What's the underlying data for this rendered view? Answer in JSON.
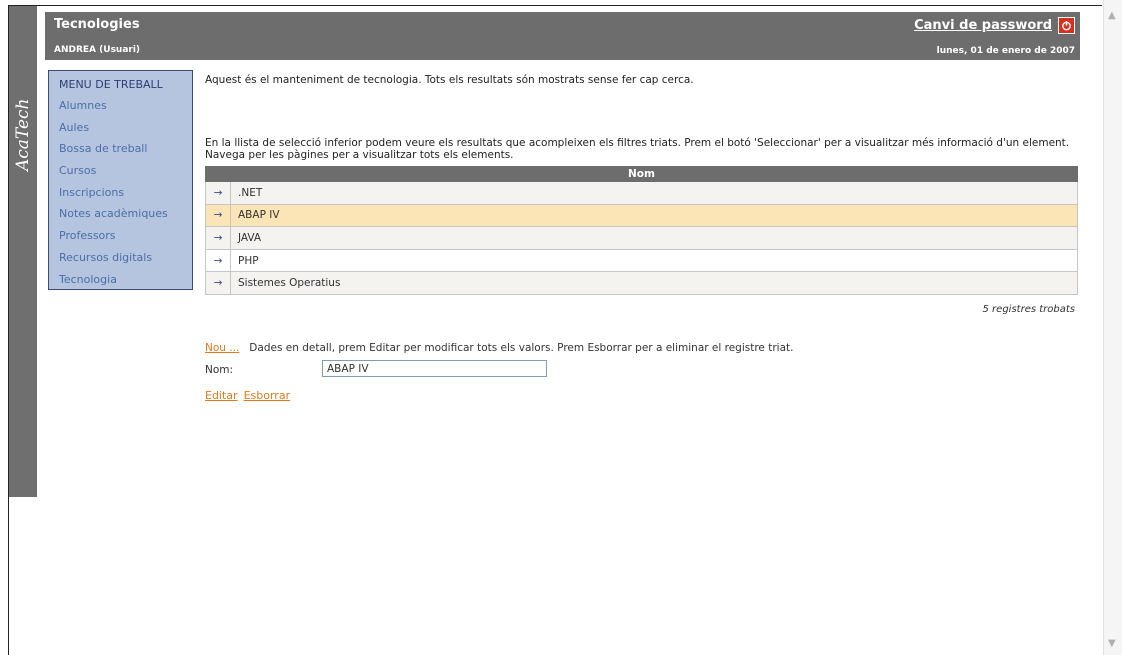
{
  "header": {
    "title": "Tecnologies",
    "user": "ANDREA (Usuari)",
    "password_link": "Canvi de password",
    "date": "lunes, 01 de enero de 2007"
  },
  "brand": "AcaTech",
  "menu": {
    "title": "MENU DE TREBALL",
    "items": [
      "Alumnes",
      "Aules",
      "Bossa de treball",
      "Cursos",
      "Inscripcions",
      "Notes acadèmiques",
      "Professors",
      "Recursos digitals",
      "Tecnologia"
    ]
  },
  "main": {
    "intro": "Aquest és el manteniment de tecnologia. Tots els resultats són mostrats sense fer cap cerca.",
    "description": "En la llista de selecció inferior podem veure els resultats que acompleixen els filtres triats. Prem el botó 'Seleccionar' per a visualitzar més informació d'un element. Navega per les pàgines per a visualitzar tots els elements.",
    "table": {
      "header": "Nom",
      "select_glyph": "→",
      "rows": [
        ".NET",
        "ABAP IV",
        "JAVA",
        "PHP",
        "Sistemes Operatius"
      ],
      "selected_index": 1
    },
    "count": "5 registres trobats"
  },
  "detail": {
    "new_link": "Nou ...",
    "info": "Dades en detall, prem Editar per modificar tots els valors. Prem Esborrar per a eliminar el registre triat.",
    "field_label": "Nom:",
    "field_value": "ABAP IV",
    "edit": "Editar",
    "delete": "Esborrar"
  },
  "colors": {
    "header_bg": "#6d6d6d",
    "menu_bg": "#b5c5df",
    "link_orange": "#e07a1a",
    "selected_row": "#fbe4b5",
    "power_red": "#d9301d"
  }
}
